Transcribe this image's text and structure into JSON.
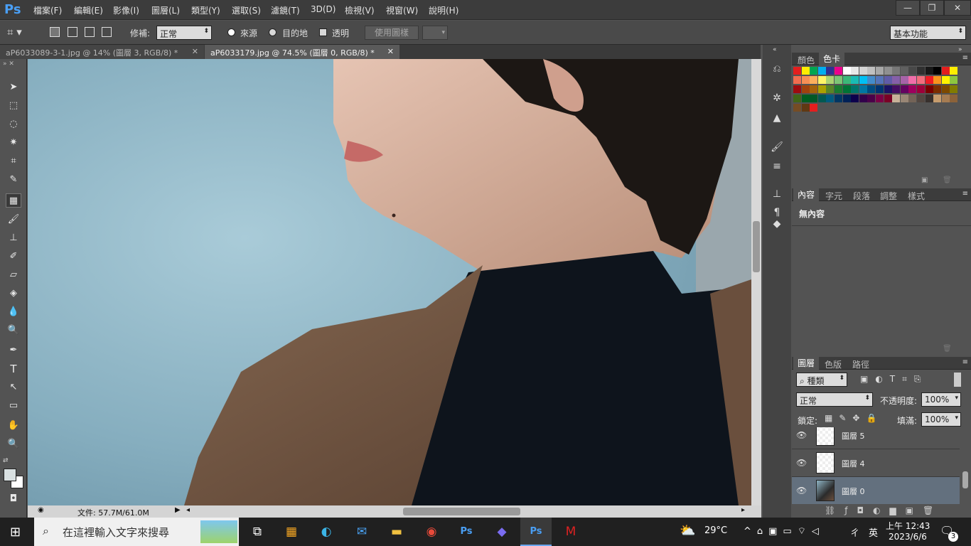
{
  "menubar": {
    "logo": "Ps",
    "items": [
      "檔案(F)",
      "編輯(E)",
      "影像(I)",
      "圖層(L)",
      "類型(Y)",
      "選取(S)",
      "濾鏡(T)",
      "3D(D)",
      "檢視(V)",
      "視窗(W)",
      "說明(H)"
    ],
    "window_controls": [
      "—",
      "❐",
      "✕"
    ]
  },
  "options": {
    "repair_label": "修補:",
    "repair_mode": "正常",
    "source_label": "來源",
    "dest_label": "目的地",
    "transparent_label": "透明",
    "use_pattern_button": "使用圖樣",
    "workspace": "基本功能"
  },
  "tabs": [
    {
      "label": "aP6033089-3-1.jpg @ 14% (圖層 3, RGB/8) *",
      "active": false
    },
    {
      "label": "aP6033179.jpg @ 74.5% (圖層 0, RGB/8) *",
      "active": true
    }
  ],
  "status": {
    "doc_size": "文件: 57.7M/61.0M"
  },
  "panels": {
    "color_tabs": [
      "顏色",
      "色卡"
    ],
    "props_tabs": [
      "內容",
      "字元",
      "段落",
      "調整",
      "樣式"
    ],
    "props_text": "無內容",
    "layers_tabs": [
      "圖層",
      "色版",
      "路徑"
    ],
    "kind_label": "種類",
    "blend_mode": "正常",
    "opacity_label": "不透明度:",
    "opacity_value": "100%",
    "lock_label": "鎖定:",
    "fill_label": "填滿:",
    "fill_value": "100%",
    "layers": [
      {
        "name": "圖層 5",
        "selected": false
      },
      {
        "name": "圖層 4",
        "selected": false
      },
      {
        "name": "圖層 0",
        "selected": true
      }
    ]
  },
  "taskbar": {
    "search_placeholder": "在這裡輸入文字來搜尋",
    "weather": "29°C",
    "ime": "英",
    "time": "上午 12:43",
    "date": "2023/6/6",
    "notification_count": "3"
  }
}
